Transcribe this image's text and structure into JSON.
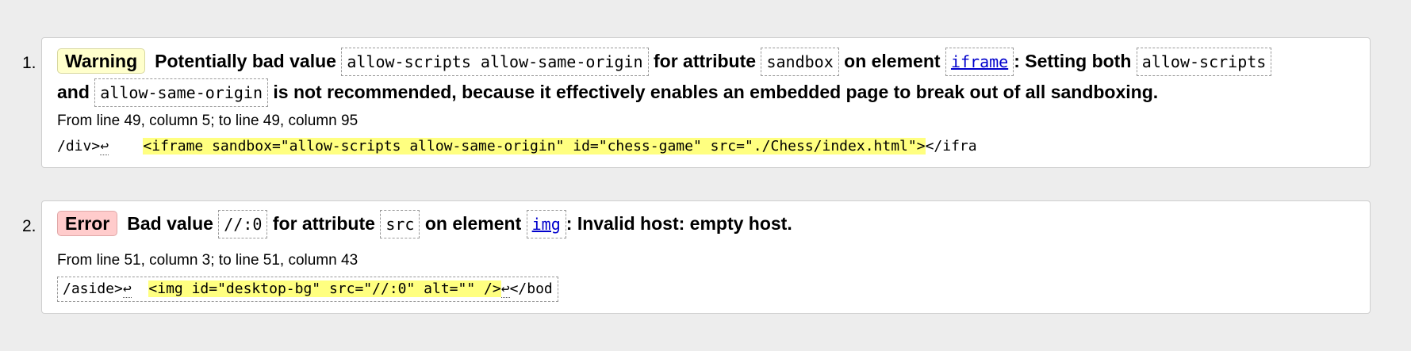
{
  "messages": [
    {
      "index": "1.",
      "type_label": "Warning",
      "text_1": "Potentially bad value",
      "code_1": "allow-scripts allow-same-origin",
      "text_2": "for attribute",
      "code_2": "sandbox",
      "text_3": "on element",
      "element_link": "iframe",
      "text_4": ": Setting both",
      "code_3": "allow-scripts",
      "text_5": "and",
      "code_4": "allow-same-origin",
      "text_6": "is not recommended, because it effectively enables an embedded page to break out of all sandboxing.",
      "location": "From line 49, column 5; to line 49, column 95",
      "extract_before": "/div>",
      "extract_return": "↩",
      "extract_gap": "    ",
      "extract_highlight": "<iframe sandbox=\"allow-scripts allow-same-origin\" id=\"chess-game\" src=\"./Chess/index.html\">",
      "extract_after": "</ifra"
    },
    {
      "index": "2.",
      "type_label": "Error",
      "text_1": "Bad value",
      "code_1": "//:0",
      "text_2": "for attribute",
      "code_2": "src",
      "text_3": "on element",
      "element_link": "img",
      "text_4": ": Invalid host: empty host.",
      "location": "From line 51, column 3; to line 51, column 43",
      "extract_before": "/aside>",
      "extract_return": "↩",
      "extract_gap": "  ",
      "extract_highlight": "<img id=\"desktop-bg\" src=\"//:0\" alt=\"\" />",
      "extract_return_2": "↩",
      "extract_after": "</bod"
    }
  ]
}
